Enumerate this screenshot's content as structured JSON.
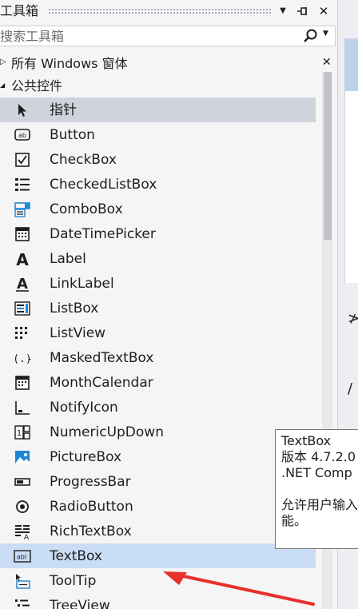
{
  "window": {
    "title": "工具箱",
    "dropdown_glyph": "▼",
    "pin_glyph": "⊣",
    "close_glyph": "✕"
  },
  "search": {
    "placeholder": "搜索工具箱",
    "dropdown_glyph": "▼"
  },
  "groups": [
    {
      "label": "所有 Windows 窗体",
      "expanded": false,
      "arrow": "▷"
    },
    {
      "label": "公共控件",
      "expanded": true,
      "arrow": "◢"
    }
  ],
  "close_glyph": "✕",
  "items": [
    {
      "label": "指针",
      "icon": "pointer-icon",
      "state": "selected"
    },
    {
      "label": "Button",
      "icon": "button-icon",
      "state": ""
    },
    {
      "label": "CheckBox",
      "icon": "checkbox-icon",
      "state": ""
    },
    {
      "label": "CheckedListBox",
      "icon": "checked-list-icon",
      "state": ""
    },
    {
      "label": "ComboBox",
      "icon": "combobox-icon",
      "state": ""
    },
    {
      "label": "DateTimePicker",
      "icon": "calendar-icon",
      "state": ""
    },
    {
      "label": "Label",
      "icon": "label-icon",
      "state": ""
    },
    {
      "label": "LinkLabel",
      "icon": "linklabel-icon",
      "state": ""
    },
    {
      "label": "ListBox",
      "icon": "listbox-icon",
      "state": ""
    },
    {
      "label": "ListView",
      "icon": "listview-icon",
      "state": ""
    },
    {
      "label": "MaskedTextBox",
      "icon": "masked-textbox-icon",
      "state": ""
    },
    {
      "label": "MonthCalendar",
      "icon": "month-calendar-icon",
      "state": ""
    },
    {
      "label": "NotifyIcon",
      "icon": "notify-icon",
      "state": ""
    },
    {
      "label": "NumericUpDown",
      "icon": "numeric-updown-icon",
      "state": ""
    },
    {
      "label": "PictureBox",
      "icon": "picturebox-icon",
      "state": ""
    },
    {
      "label": "ProgressBar",
      "icon": "progressbar-icon",
      "state": ""
    },
    {
      "label": "RadioButton",
      "icon": "radiobutton-icon",
      "state": ""
    },
    {
      "label": "RichTextBox",
      "icon": "richtextbox-icon",
      "state": ""
    },
    {
      "label": "TextBox",
      "icon": "textbox-icon",
      "state": "highlight"
    },
    {
      "label": "ToolTip",
      "icon": "tooltip-icon",
      "state": ""
    },
    {
      "label": "TreeView",
      "icon": "treeview-icon",
      "state": ""
    }
  ],
  "tooltip": {
    "title": "TextBox",
    "version": "版本 4.7.2.0",
    "framework": ".NET Comp",
    "desc_line1": "允许用户输入",
    "desc_line2": "能。"
  },
  "right_strip": {
    "glyph1": "≯",
    "glyph2": "/"
  },
  "colors": {
    "accent_red": "#e8312b",
    "selected_bg": "#cfd3dc",
    "highlight_bg": "#c9ddf5",
    "icon_blue": "#1e88d8"
  }
}
